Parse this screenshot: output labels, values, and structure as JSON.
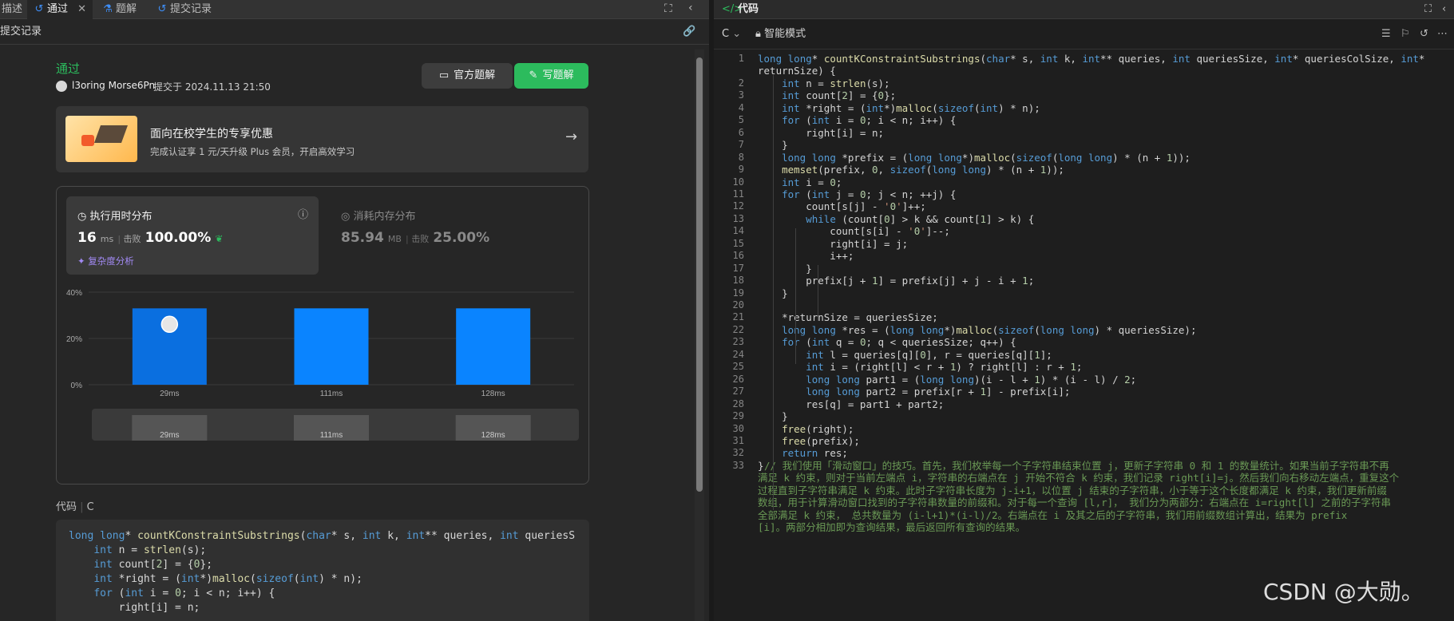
{
  "left_tabs": {
    "description": "描述",
    "passed": "通过",
    "solutions": "题解",
    "submissions": "提交记录"
  },
  "subheader": {
    "title": "提交记录"
  },
  "result": {
    "status": "通过",
    "user": "l3oring Morse6Pn",
    "submitted_at": "提交于 2024.11.13 21:50",
    "official_solution_btn": "官方题解",
    "write_solution_btn": "写题解"
  },
  "promo": {
    "title": "面向在校学生的专享优惠",
    "subtitle": "完成认证享 1 元/天升级 Plus 会员，开启高效学习"
  },
  "perf": {
    "runtime_title": "执行用时分布",
    "runtime_value": "16",
    "runtime_unit": "ms",
    "beats_label": "击败",
    "runtime_beats": "100.00%",
    "complexity_link": "复杂度分析",
    "memory_title": "消耗内存分布",
    "memory_value": "85.94",
    "memory_unit": "MB",
    "memory_beats": "25.00%"
  },
  "chart_data": {
    "type": "bar",
    "categories": [
      "29ms",
      "111ms",
      "128ms"
    ],
    "values": [
      33,
      33,
      33
    ],
    "yticks": [
      "40%",
      "20%",
      "0%"
    ],
    "ylim": [
      0,
      40
    ],
    "highlight_index": 0,
    "colors": {
      "bar": "#0a84ff",
      "highlight": "#0a6fe0"
    }
  },
  "minimap_labels": [
    "29ms",
    "111ms",
    "128ms"
  ],
  "code_section": {
    "label": "代码",
    "lang": "C"
  },
  "left_code_lines": [
    "long long* countKConstraintSubstrings(char* s, int k, int** queries, int queriesS",
    "    int n = strlen(s);",
    "    int count[2] = {0};",
    "    int *right = (int*)malloc(sizeof(int) * n);",
    "    for (int i = 0; i < n; i++) {",
    "        right[i] = n;"
  ],
  "right_panel": {
    "title": "代码",
    "lang": "C",
    "mode": "智能模式"
  },
  "code_lines": [
    {
      "n": "1",
      "t": "long long* countKConstraintSubstrings(char* s, int k, int** queries, int queriesSize, int* queriesColSize, int*"
    },
    {
      "n": "",
      "t": "returnSize) {"
    },
    {
      "n": "2",
      "t": "    int n = strlen(s);"
    },
    {
      "n": "3",
      "t": "    int count[2] = {0};"
    },
    {
      "n": "4",
      "t": "    int *right = (int*)malloc(sizeof(int) * n);"
    },
    {
      "n": "5",
      "t": "    for (int i = 0; i < n; i++) {"
    },
    {
      "n": "6",
      "t": "        right[i] = n;"
    },
    {
      "n": "7",
      "t": "    }"
    },
    {
      "n": "8",
      "t": "    long long *prefix = (long long*)malloc(sizeof(long long) * (n + 1));"
    },
    {
      "n": "9",
      "t": "    memset(prefix, 0, sizeof(long long) * (n + 1));"
    },
    {
      "n": "10",
      "t": "    int i = 0;"
    },
    {
      "n": "11",
      "t": "    for (int j = 0; j < n; ++j) {"
    },
    {
      "n": "12",
      "t": "        count[s[j] - '0']++;"
    },
    {
      "n": "13",
      "t": "        while (count[0] > k && count[1] > k) {"
    },
    {
      "n": "14",
      "t": "            count[s[i] - '0']--;"
    },
    {
      "n": "15",
      "t": "            right[i] = j;"
    },
    {
      "n": "16",
      "t": "            i++;"
    },
    {
      "n": "17",
      "t": "        }"
    },
    {
      "n": "18",
      "t": "        prefix[j + 1] = prefix[j] + j - i + 1;"
    },
    {
      "n": "19",
      "t": "    }"
    },
    {
      "n": "20",
      "t": ""
    },
    {
      "n": "21",
      "t": "    *returnSize = queriesSize;"
    },
    {
      "n": "22",
      "t": "    long long *res = (long long*)malloc(sizeof(long long) * queriesSize);"
    },
    {
      "n": "23",
      "t": "    for (int q = 0; q < queriesSize; q++) {"
    },
    {
      "n": "24",
      "t": "        int l = queries[q][0], r = queries[q][1];"
    },
    {
      "n": "25",
      "t": "        int i = (right[l] < r + 1) ? right[l] : r + 1;"
    },
    {
      "n": "26",
      "t": "        long long part1 = (long long)(i - l + 1) * (i - l) / 2;"
    },
    {
      "n": "27",
      "t": "        long long part2 = prefix[r + 1] - prefix[i];"
    },
    {
      "n": "28",
      "t": "        res[q] = part1 + part2;"
    },
    {
      "n": "29",
      "t": "    }"
    },
    {
      "n": "30",
      "t": "    free(right);"
    },
    {
      "n": "31",
      "t": "    free(prefix);"
    },
    {
      "n": "32",
      "t": "    return res;"
    },
    {
      "n": "33",
      "t": "}"
    }
  ],
  "comment_lines": [
    "// 我们使用「滑动窗口」的技巧。首先，我们枚举每一个子字符串结束位置 j，更新子字符串 0 和 1 的数量统计。如果当前子字符串不再",
    "满足 k 约束，则对于当前左端点 i，字符串的右端点在 j 开始不符合 k 约束，我们记录 right[i]=j。然后我们向右移动左端点，重复这个",
    "过程直到子字符串满足 k 约束。此时子字符串长度为 j-i+1，以位置 j 结束的子字符串，小于等于这个长度都满足 k 约束，我们更新前缀",
    "数组，用于计算滑动窗口找到的子字符串数量的前缀和。对于每一个查询 [l,r]， 我们分为两部分：右端点在 i=right[l] 之前的子字符串",
    "全部满足 k 约束， 总共数量为 (i-l+1)*(i-l)/2。右端点在 i 及其之后的子字符串，我们用前缀数组计算出，结果为 prefix",
    "[i]。两部分相加即为查询结果，最后返回所有查询的结果。"
  ],
  "watermark": "CSDN @大勋。"
}
